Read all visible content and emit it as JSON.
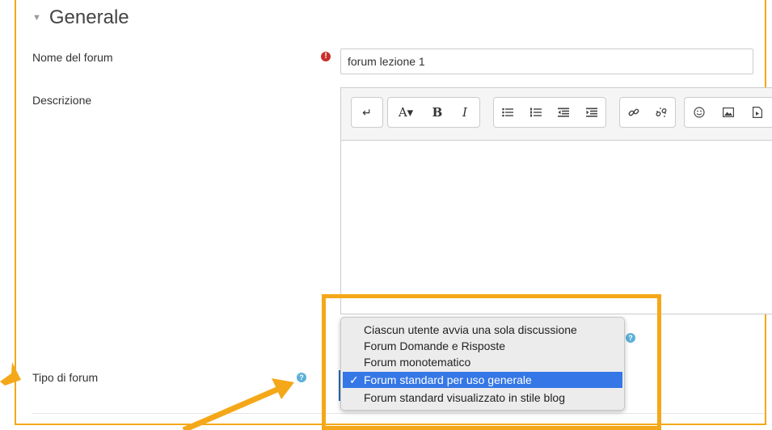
{
  "section": {
    "title": "Generale",
    "collapse_icon": "chevron-down-icon"
  },
  "fields": {
    "forum_name": {
      "label": "Nome del forum",
      "value": "forum lezione 1",
      "required_icon": "exclamation-icon"
    },
    "description": {
      "label": "Descrizione"
    },
    "forum_type": {
      "label": "Tipo di forum",
      "help_icon": "question-icon"
    }
  },
  "toolbar": {
    "groups": [
      [
        "toggle-icon"
      ],
      [
        "font-size-icon",
        "bold-icon",
        "italic-icon"
      ],
      [
        "unordered-list-icon",
        "ordered-list-icon",
        "outdent-icon",
        "indent-icon"
      ],
      [
        "link-icon",
        "unlink-icon"
      ],
      [
        "emoji-icon",
        "image-icon",
        "media-icon"
      ]
    ]
  },
  "dropdown": {
    "options": [
      "Ciascun utente avvia una sola discussione",
      "Forum Domande e Risposte",
      "Forum monotematico",
      "Forum standard per uso generale",
      "Forum standard visualizzato in stile blog"
    ],
    "selected": "Forum standard per uso generale"
  },
  "annotation_color": "#f4a819",
  "required_color": "#c9302c",
  "help_color": "#5bb0d9",
  "selection_color": "#3577e6"
}
